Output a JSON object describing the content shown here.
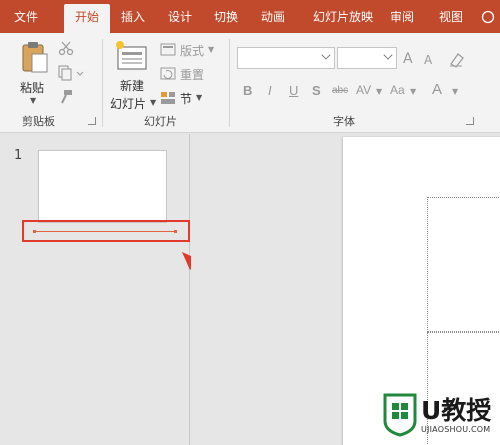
{
  "tabs": [
    {
      "label": "文件",
      "active": false
    },
    {
      "label": "开始",
      "active": true
    },
    {
      "label": "插入",
      "active": false
    },
    {
      "label": "设计",
      "active": false
    },
    {
      "label": "切换",
      "active": false
    },
    {
      "label": "动画",
      "active": false
    },
    {
      "label": "幻灯片放映",
      "active": false
    },
    {
      "label": "审阅",
      "active": false
    },
    {
      "label": "视图",
      "active": false
    },
    {
      "label": "",
      "active": false
    }
  ],
  "ribbon": {
    "clipboard": {
      "paste_label": "粘贴",
      "group_label": "剪贴板"
    },
    "slides": {
      "new_slide_line1": "新建",
      "new_slide_line2": "幻灯片",
      "layout_label": "版式",
      "reset_label": "重置",
      "section_label": "节",
      "group_label": "幻灯片"
    },
    "font": {
      "font_name_value": "",
      "font_size_value": "",
      "grow_label": "A",
      "shrink_label": "A",
      "bold_label": "B",
      "italic_label": "I",
      "underline_label": "U",
      "shadow_label": "S",
      "strike_label": "abc",
      "spacing_label": "AV",
      "case_label": "Aa",
      "color_label": "A",
      "group_label": "字体"
    }
  },
  "thumbnails": {
    "slide_number": "1"
  },
  "watermark": {
    "brand": "U教授",
    "url": "UJIAOSHOU.COM"
  },
  "colors": {
    "accent": "#c24a2c",
    "highlight": "#e23a2a",
    "watermark": "#1f8a3c"
  }
}
